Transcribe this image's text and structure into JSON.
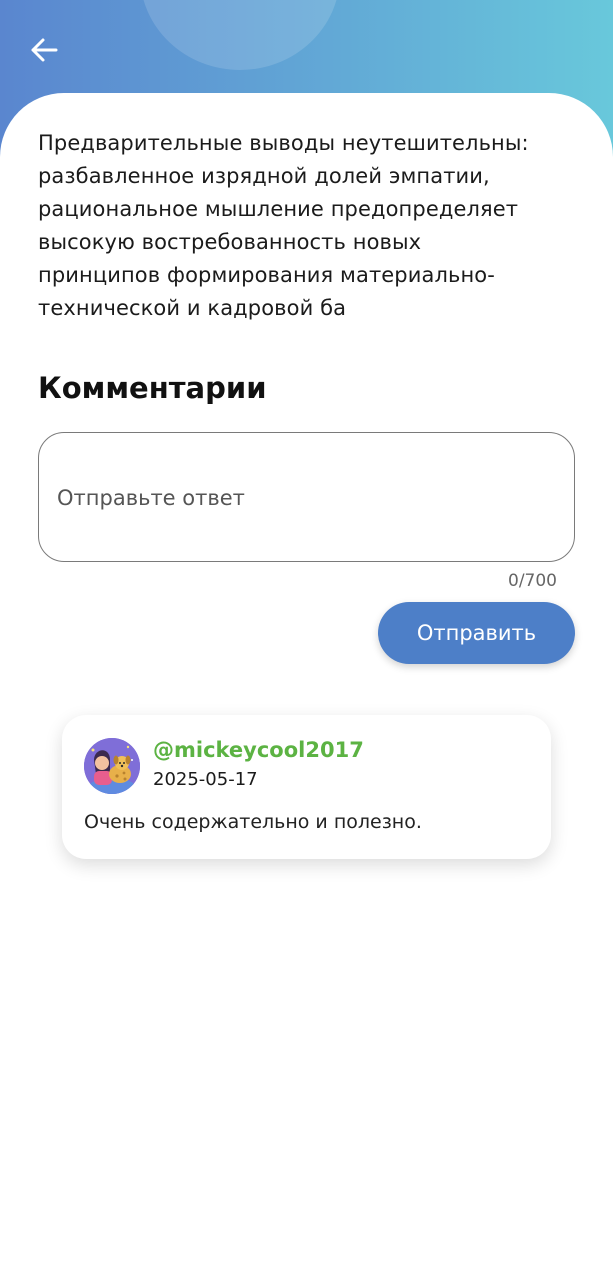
{
  "article": {
    "text_lines": [
      "Предварительные выводы неутешительны:",
      "разбавленное изрядной долей эмпатии,",
      "рациональное мышление предопределяет",
      "высокую востребованность новых",
      "принципов формирования материально-",
      "технической и кадровой ба"
    ]
  },
  "comments": {
    "title": "Комментарии",
    "reply_placeholder": "Отправьте ответ",
    "reply_value": "",
    "char_counter": "0/700",
    "send_label": "Отправить",
    "items": [
      {
        "username": "@mickeycool2017",
        "date": "2025-05-17",
        "text": "Очень содержательно и полезно.",
        "avatar_icon": "avatar-girl-with-dog-icon"
      }
    ]
  },
  "header": {
    "back_icon": "arrow-left-icon"
  },
  "colors": {
    "header_gradient_start": "#5a86cf",
    "header_gradient_end": "#68c8db",
    "accent": "#4d7fc8",
    "username": "#5cb343"
  }
}
